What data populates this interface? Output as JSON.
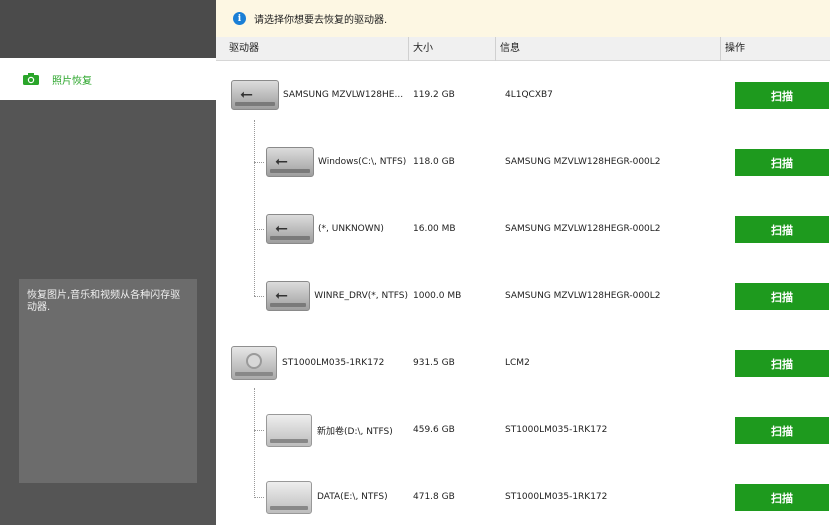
{
  "sidebar": {
    "active_item": "照片恢复",
    "description": "恢复图片,音乐和视频从各种闪存驱动器."
  },
  "notice": {
    "text": "请选择你想要去恢复的驱动器."
  },
  "table": {
    "headers": [
      "驱动器",
      "大小",
      "信息",
      "操作"
    ],
    "rows": [
      {
        "name": "SAMSUNG MZVLW128HE...",
        "size": "119.2 GB",
        "info": "4L1QCXB7",
        "action": "扫描",
        "kind": "usb",
        "level": 0
      },
      {
        "name": "Windows(C:\\, NTFS)",
        "size": "118.0 GB",
        "info": "SAMSUNG MZVLW128HEGR-000L2",
        "action": "扫描",
        "kind": "usb",
        "level": 1
      },
      {
        "name": "(*, UNKNOWN)",
        "size": "16.00 MB",
        "info": "SAMSUNG MZVLW128HEGR-000L2",
        "action": "扫描",
        "kind": "usb",
        "level": 1
      },
      {
        "name": "WINRE_DRV(*, NTFS)",
        "size": "1000.0 MB",
        "info": "SAMSUNG MZVLW128HEGR-000L2",
        "action": "扫描",
        "kind": "usb",
        "level": 1
      },
      {
        "name": "ST1000LM035-1RK172",
        "size": "931.5 GB",
        "info": "LCM2",
        "action": "扫描",
        "kind": "hdd",
        "level": 0
      },
      {
        "name": "新加卷(D:\\, NTFS)",
        "size": "459.6 GB",
        "info": "ST1000LM035-1RK172",
        "action": "扫描",
        "kind": "volume",
        "level": 1
      },
      {
        "name": "DATA(E:\\, NTFS)",
        "size": "471.8 GB",
        "info": "ST1000LM035-1RK172",
        "action": "扫描",
        "kind": "volume",
        "level": 1
      }
    ]
  },
  "colors": {
    "accent_green": "#1e9a1e",
    "sidebar_bg": "#4b4b4b",
    "notice_bg": "#fdf7e3",
    "info_blue": "#1a7fd6"
  },
  "icons": {
    "sidebar_active": "camera-icon",
    "notice": "info-icon",
    "usb": "usb-drive-icon",
    "hdd": "hard-disk-icon",
    "volume": "volume-icon"
  }
}
